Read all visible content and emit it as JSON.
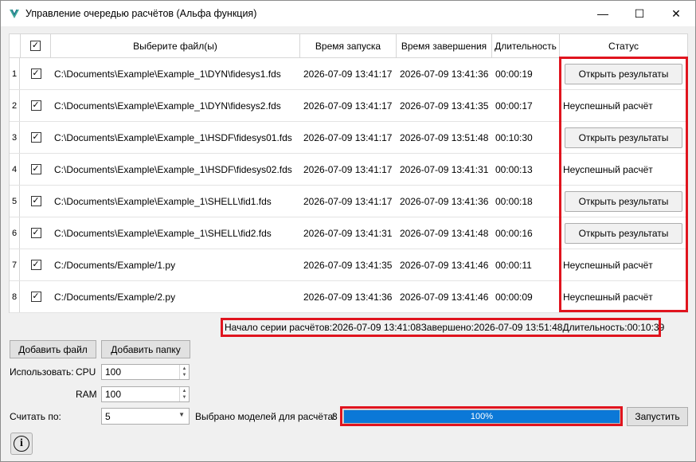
{
  "window": {
    "title": "Управление очередью расчётов (Альфа функция)",
    "controls": {
      "minimize": "—",
      "maximize": "☐",
      "close": "✕"
    }
  },
  "table": {
    "headers": {
      "file": "Выберите файл(ы)",
      "start": "Время запуска",
      "end": "Время завершения",
      "duration": "Длительность",
      "status": "Статус"
    },
    "header_checked": true,
    "rows": [
      {
        "num": "1",
        "checked": true,
        "file": "C:\\Documents\\Example\\Example_1\\DYN\\fidesys1.fds",
        "start": "2026-07-09 13:41:17",
        "end": "2026-07-09 13:41:36",
        "duration": "00:00:19",
        "status_type": "button",
        "status": "Открыть результаты"
      },
      {
        "num": "2",
        "checked": true,
        "file": "C:\\Documents\\Example\\Example_1\\DYN\\fidesys2.fds",
        "start": "2026-07-09 13:41:17",
        "end": "2026-07-09 13:41:35",
        "duration": "00:00:17",
        "status_type": "text",
        "status": "Неуспешный расчёт"
      },
      {
        "num": "3",
        "checked": true,
        "file": "C:\\Documents\\Example\\Example_1\\HSDF\\fidesys01.fds",
        "start": "2026-07-09 13:41:17",
        "end": "2026-07-09 13:51:48",
        "duration": "00:10:30",
        "status_type": "button",
        "status": "Открыть результаты"
      },
      {
        "num": "4",
        "checked": true,
        "file": "C:\\Documents\\Example\\Example_1\\HSDF\\fidesys02.fds",
        "start": "2026-07-09 13:41:17",
        "end": "2026-07-09 13:41:31",
        "duration": "00:00:13",
        "status_type": "text",
        "status": "Неуспешный расчёт"
      },
      {
        "num": "5",
        "checked": true,
        "file": "C:\\Documents\\Example\\Example_1\\SHELL\\fid1.fds",
        "start": "2026-07-09 13:41:17",
        "end": "2026-07-09 13:41:36",
        "duration": "00:00:18",
        "status_type": "button",
        "status": "Открыть результаты"
      },
      {
        "num": "6",
        "checked": true,
        "file": "C:\\Documents\\Example\\Example_1\\SHELL\\fid2.fds",
        "start": "2026-07-09 13:41:31",
        "end": "2026-07-09 13:41:48",
        "duration": "00:00:16",
        "status_type": "button",
        "status": "Открыть результаты"
      },
      {
        "num": "7",
        "checked": true,
        "file": "C:/Documents/Example/1.py",
        "start": "2026-07-09 13:41:35",
        "end": "2026-07-09 13:41:46",
        "duration": "00:00:11",
        "status_type": "text",
        "status": "Неуспешный расчёт"
      },
      {
        "num": "8",
        "checked": true,
        "file": "C:/Documents/Example/2.py",
        "start": "2026-07-09 13:41:36",
        "end": "2026-07-09 13:41:46",
        "duration": "00:00:09",
        "status_type": "text",
        "status": "Неуспешный расчёт"
      }
    ]
  },
  "summary": {
    "start_label": "Начало серии расчётов:",
    "start_value": "2026-07-09 13:41:08",
    "end_label": "Завершено:",
    "end_value": "2026-07-09 13:51:48",
    "duration_label": "Длительность:",
    "duration_value": "00:10:39"
  },
  "buttons": {
    "add_file": "Добавить файл",
    "add_folder": "Добавить папку",
    "run": "Запустить"
  },
  "resources": {
    "use_label": "Использовать:",
    "cpu_label": "CPU",
    "cpu_value": "100",
    "ram_label": "RAM",
    "ram_value": "100"
  },
  "count": {
    "label": "Считать по:",
    "value": "5",
    "selected_label": "Выбрано моделей для расчёта:",
    "selected_value": "8"
  },
  "progress": {
    "value": 100,
    "text": "100%"
  },
  "colors": {
    "highlight": "#e0141e",
    "progress": "#0b78d7"
  },
  "icons": {
    "app": "app-logo-icon",
    "info": "info-icon"
  }
}
